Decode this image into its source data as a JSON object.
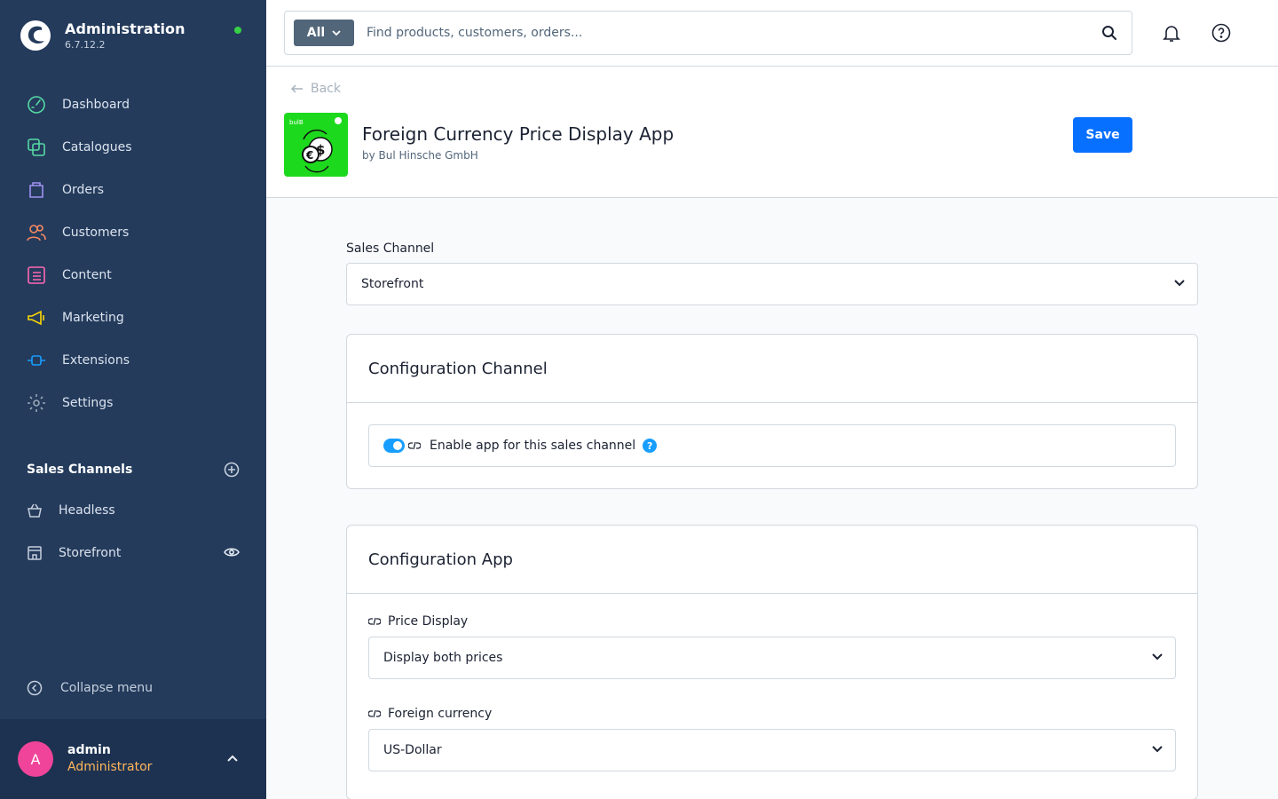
{
  "sidebar": {
    "brand_title": "Administration",
    "version": "6.7.12.2",
    "nav": [
      {
        "label": "Dashboard",
        "icon": "dashboard-icon",
        "color": "#57d9a3"
      },
      {
        "label": "Catalogues",
        "icon": "catalogue-icon",
        "color": "#57d9a3"
      },
      {
        "label": "Orders",
        "icon": "orders-icon",
        "color": "#a092f0"
      },
      {
        "label": "Customers",
        "icon": "customers-icon",
        "color": "#f88962"
      },
      {
        "label": "Content",
        "icon": "content-icon",
        "color": "#ff68b4"
      },
      {
        "label": "Marketing",
        "icon": "marketing-icon",
        "color": "#ffd700"
      },
      {
        "label": "Extensions",
        "icon": "extensions-icon",
        "color": "#189eff"
      },
      {
        "label": "Settings",
        "icon": "settings-icon",
        "color": "#9aa8b5"
      }
    ],
    "sales_channels_title": "Sales Channels",
    "sales_channels": [
      {
        "label": "Headless",
        "icon": "basket-icon"
      },
      {
        "label": "Storefront",
        "icon": "storefront-icon"
      }
    ],
    "collapse_label": "Collapse menu",
    "user": {
      "initial": "A",
      "name": "admin",
      "role": "Administrator"
    }
  },
  "topbar": {
    "search_type": "All",
    "search_placeholder": "Find products, customers, orders..."
  },
  "header": {
    "back_label": "Back",
    "app_title": "Foreign Currency Price Display App",
    "vendor": "by Bul Hinsche GmbH",
    "save_label": "Save",
    "logo_text": "bulB"
  },
  "content": {
    "sales_channel_label": "Sales Channel",
    "sales_channel_value": "Storefront",
    "channel_card_title": "Configuration Channel",
    "enable_label": "Enable app for this sales channel",
    "enable_value": true,
    "app_card_title": "Configuration App",
    "price_display_label": "Price Display",
    "price_display_value": "Display both prices",
    "foreign_currency_label": "Foreign currency",
    "foreign_currency_value": "US-Dollar"
  },
  "colors": {
    "sidebar_bg": "#243b5c",
    "primary": "#0870ff",
    "toggle": "#189eff",
    "online": "#37d046",
    "avatar": "#f0449a",
    "role": "#ffb75d",
    "app_logo": "#1dd91d"
  }
}
